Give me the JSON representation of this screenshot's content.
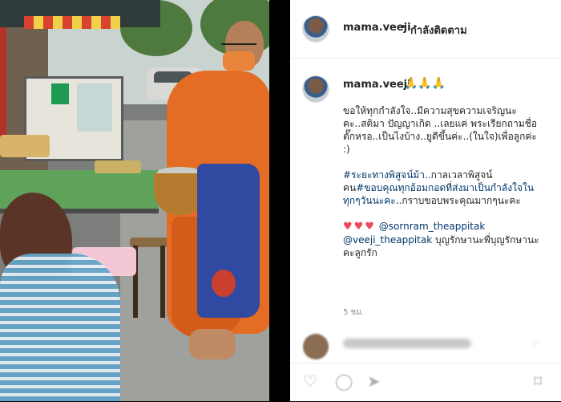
{
  "post": {
    "header": {
      "username": "mama.veeji",
      "separator": "•",
      "follow_status": "กำลังติดตาม"
    },
    "caption": {
      "username": "mama.veeji",
      "emoji": "🙏🙏🙏",
      "paragraph1": "ขอให้ทุกกำลังใจ..มีความสุขความเจริญนะคะ..สติมา ปัญญาเกิด ..เลยแค่ พระเรียกถามชื่อ ตั๊กหรอ..เป็นไงบ้าง..ยูดีขึ้นค่ะ..(ในใจ)เพื่อลูกค่ะ :)",
      "tag1": "#ระยะทางพิสูจน์ม้า",
      "text1": "..กาลเวลาพิสูจน์คน",
      "tag2": "#ขอบคุณทุกอ้อมกอดที่ส่งมาเป็นกำลังใจในทุกๆวันนะคะ",
      "text2": "..กราบขอบพระคุณมากๆนะคะ",
      "hearts": "♥♥♥",
      "mention1": "@sornram_theappitak",
      "mention2": "@veeji_theappitak",
      "text3": " บุญรักษานะพี่บุญรักษานะคะลูกรัก"
    },
    "timestamp": "5 ชม."
  },
  "icons": {
    "like": "heart-icon",
    "comment": "comment-icon",
    "share": "share-icon",
    "save": "bookmark-icon"
  },
  "colors": {
    "link": "#00376b",
    "heart": "#ed4956",
    "robe": "#e46c24"
  }
}
